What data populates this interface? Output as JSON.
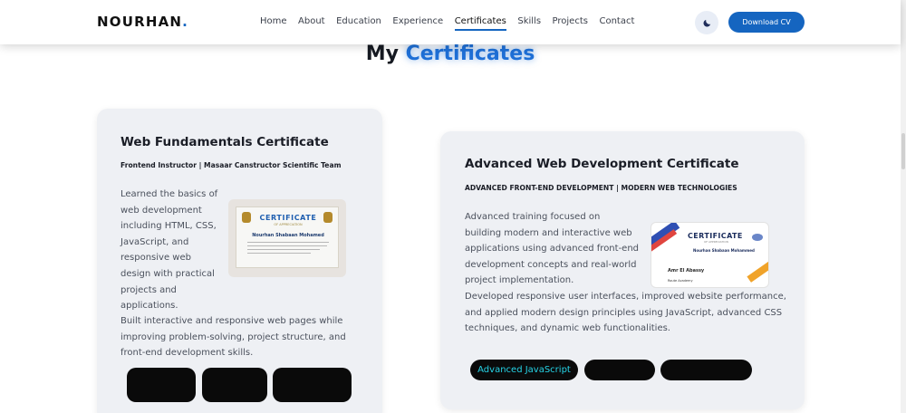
{
  "brand": {
    "name": "NOURHAN",
    "dot": "."
  },
  "nav": {
    "items": [
      "Home",
      "About",
      "Education",
      "Experience",
      "Certificates",
      "Skills",
      "Projects",
      "Contact"
    ],
    "active": "Certificates"
  },
  "actions": {
    "theme_icon": "moon-icon",
    "download_cv": "Download CV"
  },
  "section": {
    "title_plain": "My",
    "title_accent": "Certificates"
  },
  "cards": [
    {
      "title": "Web Fundamentals Certificate",
      "subtitle": "Frontend Instructor | Masaar Canstructor Scientific Team",
      "text1": "Learned the basics of web development including HTML, CSS, JavaScript, and responsive web design with practical projects and applications.",
      "text2": "Built interactive and responsive web pages while improving problem-solving, project structure, and front-end development skills.",
      "certificate": {
        "heading": "CERTIFICATE",
        "subheading": "OF APPRECIATION",
        "recipient": "Nourhan Shabaan Mohamed"
      },
      "tags": [
        "",
        "",
        ""
      ]
    },
    {
      "title": "Advanced Web Development Certificate",
      "subtitle": "ADVANCED FRONT-END DEVELOPMENT | MODERN WEB TECHNOLOGIES",
      "text1": "Advanced training focused on building modern and interactive web applications using advanced front-end development concepts and real-world project implementation.",
      "text2": "Developed responsive user interfaces, improved website performance, and applied modern design principles using JavaScript, advanced CSS techniques, and dynamic web functionalities.",
      "certificate": {
        "heading": "CERTIFICATE",
        "subheading": "OF APPRECIATION",
        "recipient": "Nourhan Shabaan Mohammed",
        "signatory": "Amr El Abassy",
        "footer": "Route Academy"
      },
      "tags": [
        "Advanced JavaScript",
        "",
        ""
      ]
    }
  ],
  "colors": {
    "accent": "#1565c0",
    "card_bg": "#eef0f4",
    "tag_bg": "#0a0a0a",
    "tag_text": "#26d3e6"
  }
}
